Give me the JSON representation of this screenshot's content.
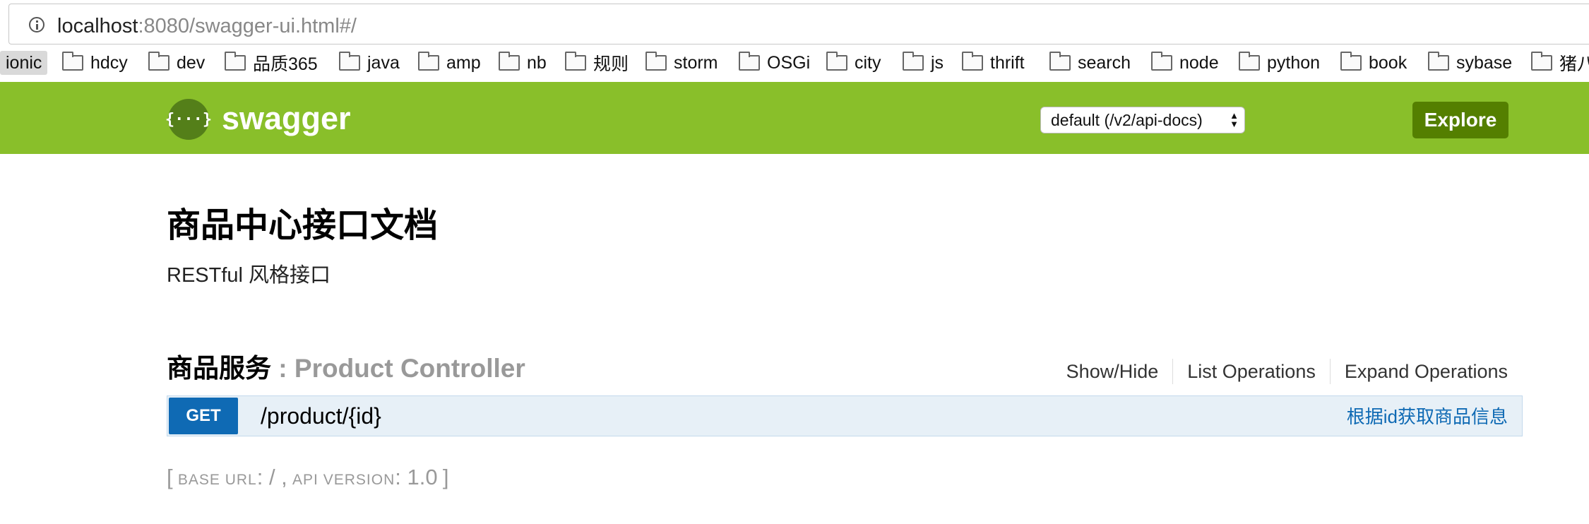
{
  "browser": {
    "url_host": "localhost",
    "url_rest": ":8080/swagger-ui.html#/",
    "bookmarks": [
      "ionic",
      "hdcy",
      "dev",
      "品质365",
      "java",
      "amp",
      "nb",
      "规则",
      "storm",
      "OSGi",
      "city",
      "js",
      "thrift",
      "search",
      "node",
      "python",
      "book",
      "sybase",
      "猪八"
    ]
  },
  "header": {
    "logo_symbol": "{···}",
    "title": "swagger",
    "spec_select": "default (/v2/api-docs)",
    "explore_label": "Explore",
    "brand_color": "#89bf2a"
  },
  "api": {
    "title": "商品中心接口文档",
    "description": "RESTful 风格接口"
  },
  "resource": {
    "name": "商品服务",
    "separator": " : ",
    "controller": "Product Controller",
    "ops": {
      "show_hide": "Show/Hide",
      "list": "List Operations",
      "expand": "Expand Operations"
    },
    "endpoint": {
      "method": "GET",
      "path": "/product/{id}",
      "summary": "根据id获取商品信息"
    }
  },
  "footer": {
    "open_bracket": "[",
    "base_url_label": "BASE URL",
    "base_url_value": ": / ,",
    "api_version_label": "API VERSION",
    "api_version_value": ": 1.0",
    "close_bracket": "]"
  }
}
